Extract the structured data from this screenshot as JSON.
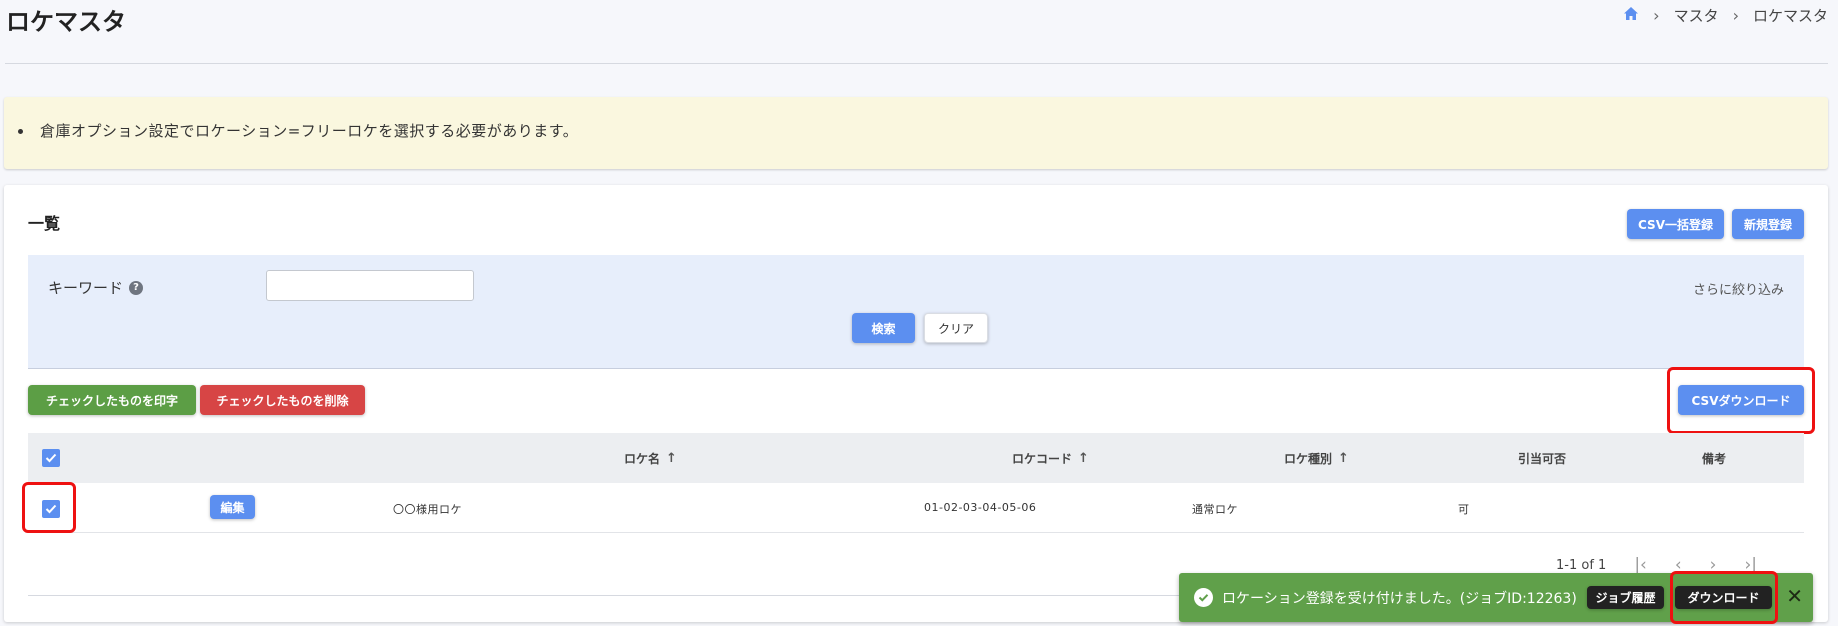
{
  "header": {
    "title": "ロケマスタ",
    "breadcrumb": [
      "マスタ",
      "ロケマスタ"
    ]
  },
  "notice": {
    "items": [
      "倉庫オプション設定でロケーション=フリーロケを選択する必要があります。"
    ]
  },
  "card": {
    "title": "一覧",
    "csv_bulk_label": "CSV一括登録",
    "new_label": "新規登録"
  },
  "filter": {
    "keyword_label": "キーワード",
    "keyword_value": "",
    "more_label": "さらに絞り込み",
    "search_label": "検索",
    "clear_label": "クリア"
  },
  "actions": {
    "print_label": "チェックしたものを印字",
    "delete_label": "チェックしたものを削除",
    "csv_download_label": "CSVダウンロード"
  },
  "table": {
    "columns": [
      "ロケ名",
      "ロケコード",
      "ロケ種別",
      "引当可否",
      "備考"
    ],
    "rows": [
      {
        "checked": true,
        "edit_label": "編集",
        "name": "〇〇様用ロケ",
        "code": "01-02-03-04-05-06",
        "type": "通常ロケ",
        "allocatable": "可",
        "note": ""
      }
    ]
  },
  "pagination": {
    "summary": "1-1 of 1"
  },
  "toast": {
    "message": "ロケーション登録を受け付けました。(ジョブID:12263)",
    "job_history_label": "ジョブ履歴",
    "download_label": "ダウンロード"
  },
  "colors": {
    "primary": "#5c8ff0",
    "success": "#5c9e45",
    "danger": "#d74545",
    "toast": "#60a04a",
    "highlight": "#ee1111"
  }
}
